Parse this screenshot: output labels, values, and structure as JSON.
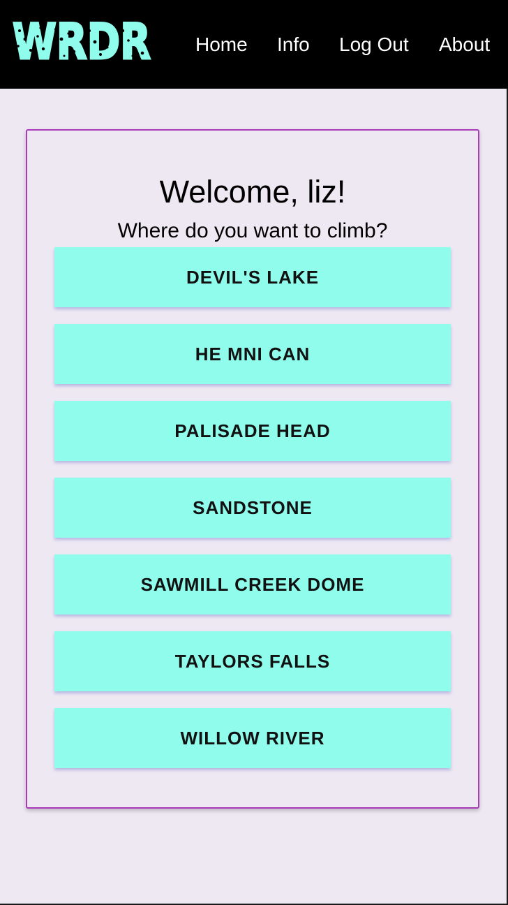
{
  "brand": {
    "logo_text": "WRDR",
    "logo_color": "#8ffcec"
  },
  "nav": {
    "home": "Home",
    "info": "Info",
    "logout": "Log Out",
    "about": "About"
  },
  "main": {
    "welcome": "Welcome, liz!",
    "prompt": "Where do you want to climb?",
    "areas": [
      "DEVIL'S LAKE",
      "HE MNI CAN",
      "PALISADE HEAD",
      "SANDSTONE",
      "SAWMILL CREEK DOME",
      "TAYLORS FALLS",
      "WILLOW RIVER"
    ]
  },
  "colors": {
    "navbar_bg": "#000000",
    "page_bg": "#eee8f2",
    "card_border": "#a83cb8",
    "button_bg": "#8ffcec"
  }
}
